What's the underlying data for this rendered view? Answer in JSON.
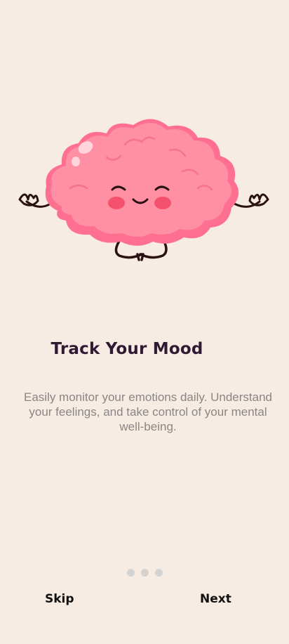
{
  "onboarding": {
    "title": "Track Your Mood",
    "description": "Easily monitor your emotions daily. Understand your feelings, and take control of your mental well-being.",
    "illustration": "meditating-brain-mascot",
    "page_indicator": {
      "total": 3
    },
    "skip_label": "Skip",
    "next_label": "Next"
  },
  "colors": {
    "background": "#f7ece3",
    "brain": "#ff8fa3",
    "brain_shadow": "#ff7090",
    "cheek": "#f4516c",
    "title": "#2f1a33",
    "text_muted": "#8a8585",
    "dot": "#d4d2d1"
  }
}
